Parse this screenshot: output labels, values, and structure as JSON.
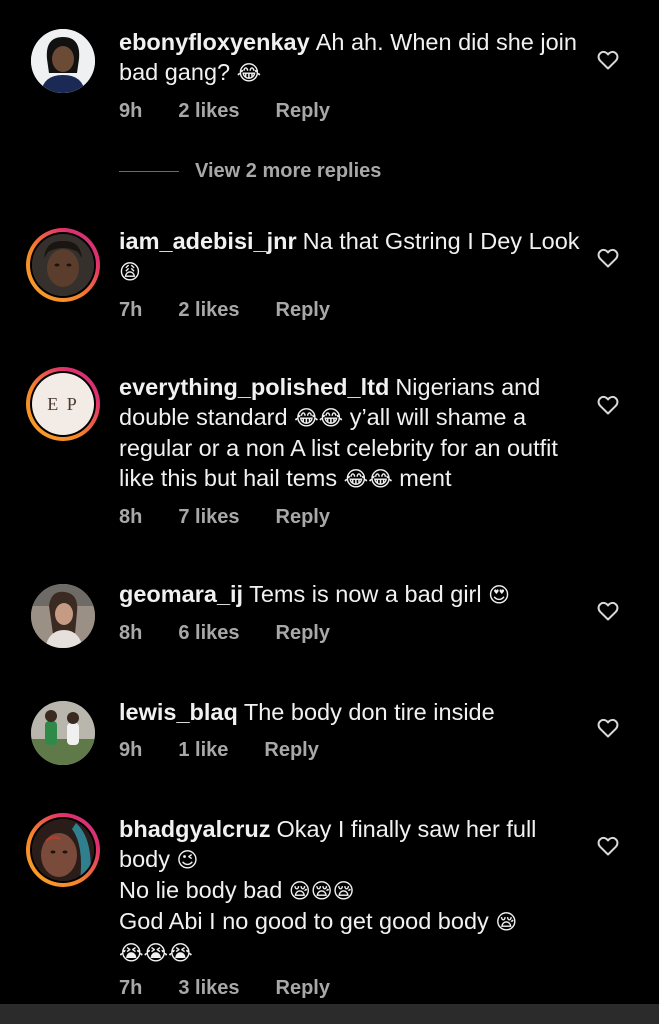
{
  "comments": [
    {
      "username": "ebonyfloxyenkay",
      "text": "Ah ah. When did she join bad gang?",
      "emoji_after": "😂",
      "time": "9h",
      "likes": "2 likes",
      "reply": "Reply"
    },
    {
      "username": "iam_adebisi_jnr",
      "text": "Na that Gstring I Dey Look",
      "emoji_after": "😩",
      "time": "7h",
      "likes": "2 likes",
      "reply": "Reply"
    },
    {
      "username": "everything_polished_ltd",
      "text_a": "Nigerians and double standard",
      "emoji_a": "😂😂",
      "text_b": "y’all will shame a regular or a non A list celebrity  for an outfit like this but hail tems",
      "emoji_b": "😂😂",
      "text_c": "ment",
      "avatar_monogram": "E P",
      "time": "8h",
      "likes": "7 likes",
      "reply": "Reply"
    },
    {
      "username": "geomara_ij",
      "text": "Tems is now a bad girl",
      "emoji_after": "😍",
      "time": "8h",
      "likes": "6 likes",
      "reply": "Reply"
    },
    {
      "username": "lewis_blaq",
      "text": "The body don tire inside",
      "time": "9h",
      "likes": "1 like",
      "reply": "Reply"
    },
    {
      "username": "bhadgyalcruz",
      "text_a": "Okay I finally saw her full body",
      "emoji_a": "😉",
      "text_b": "No lie body bad",
      "emoji_b": "😪😪😪",
      "text_c": "God Abi I no good to get good body",
      "emoji_c": "😪",
      "emoji_d": "😭😭😭",
      "time": "7h",
      "likes": "3 likes",
      "reply": "Reply"
    }
  ],
  "view_more_replies": "View 2 more replies",
  "colors": {
    "background": "#000000",
    "secondary_text": "#a8a8a8",
    "primary_text": "#f1f1f1"
  },
  "icons": {
    "like": "heart-outline-icon"
  }
}
